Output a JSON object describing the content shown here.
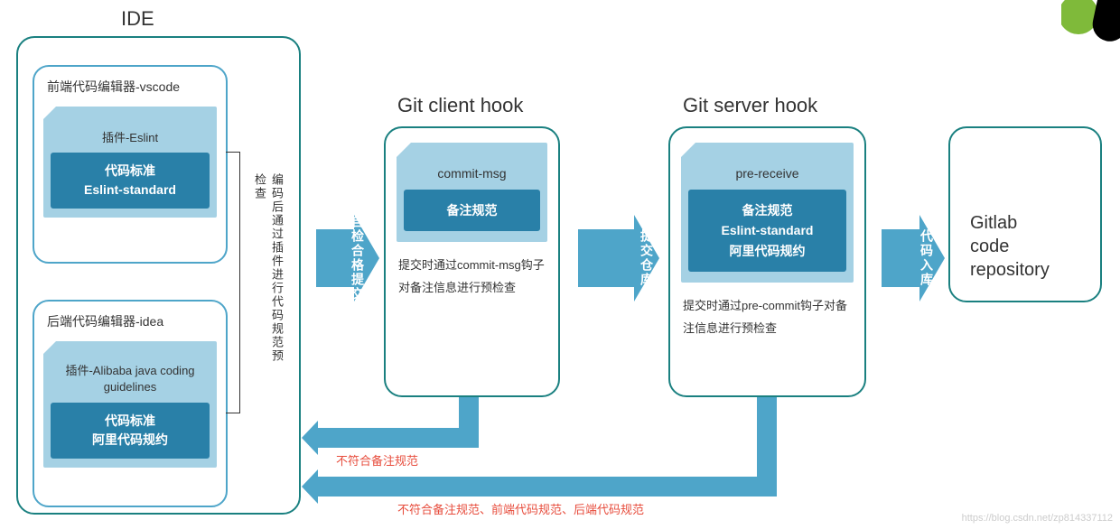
{
  "titles": {
    "ide": "IDE",
    "client": "Git client hook",
    "server": "Git server hook"
  },
  "ide": {
    "vscode": {
      "editor": "前端代码编辑器-vscode",
      "plugin": "插件-Eslint",
      "std1": "代码标准",
      "std2": "Eslint-standard"
    },
    "idea": {
      "editor": "后端代码编辑器-idea",
      "plugin": "插件-Alibaba java coding guidelines",
      "std1": "代码标准",
      "std2": "阿里代码规约"
    },
    "side_note": "编码后通过插件进行代码规范预检查"
  },
  "arrows": {
    "a1": "自检合格提交",
    "a2": "提交仓库",
    "a3": "代码入库"
  },
  "client_hook": {
    "name": "commit-msg",
    "body": "备注规范",
    "desc": "提交时通过commit-msg钩子对备注信息进行预检查"
  },
  "server_hook": {
    "name": "pre-receive",
    "body1": "备注规范",
    "body2": "Eslint-standard",
    "body3": "阿里代码规约",
    "desc": "提交时通过pre-commit钩子对备注信息进行预检查"
  },
  "repo": {
    "l1": "Gitlab",
    "l2": "code",
    "l3": "repository"
  },
  "reject": {
    "r1": "不符合备注规范",
    "r2": "不符合备注规范、前端代码规范、后端代码规范"
  },
  "watermark": "https://blog.csdn.net/zp814337112"
}
